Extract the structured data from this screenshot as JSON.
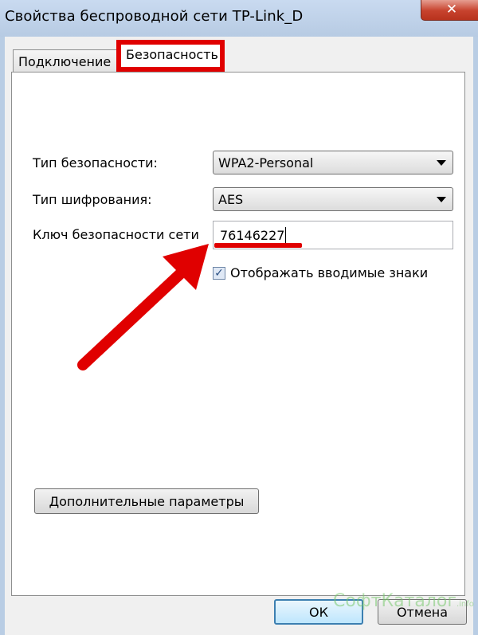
{
  "window": {
    "title": "Свойства беспроводной сети TP-Link_D",
    "close_glyph": "✕"
  },
  "tabs": [
    {
      "label": "Подключение",
      "selected": false
    },
    {
      "label": "Безопасность",
      "selected": true
    }
  ],
  "security": {
    "security_type_label": "Тип безопасности:",
    "security_type_value": "WPA2-Personal",
    "encryption_type_label": "Тип шифрования:",
    "encryption_type_value": "AES",
    "network_key_label": "Ключ безопасности сети",
    "network_key_value": "76146227",
    "show_chars_label": "Отображать вводимые знаки",
    "show_chars_checked": true,
    "advanced_button": "Дополнительные параметры"
  },
  "footer": {
    "ok_button": "ОК",
    "cancel_button": "Отмена"
  },
  "watermark": {
    "text": "СофтКаталог",
    "suffix": ".info"
  },
  "colors": {
    "highlight": "#e00000",
    "watermark": "#78c86e"
  },
  "icons": {
    "close": "close-icon",
    "dropdown": "chevron-down-icon",
    "check": "checkmark-icon"
  }
}
